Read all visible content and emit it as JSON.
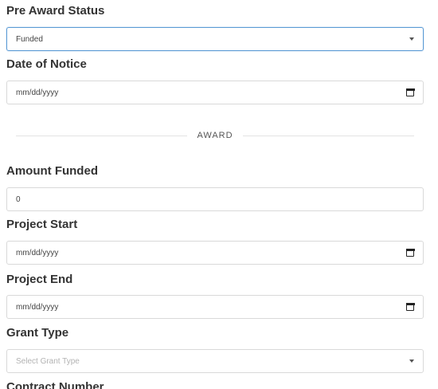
{
  "pre_award_status": {
    "label": "Pre Award Status",
    "value": "Funded"
  },
  "date_of_notice": {
    "label": "Date of Notice",
    "value": "mm/dd/yyyy"
  },
  "section": {
    "title": "AWARD"
  },
  "amount_funded": {
    "label": "Amount Funded",
    "value": "0"
  },
  "project_start": {
    "label": "Project Start",
    "value": "mm/dd/yyyy"
  },
  "project_end": {
    "label": "Project End",
    "value": "mm/dd/yyyy"
  },
  "grant_type": {
    "label": "Grant Type",
    "placeholder": "Select Grant Type"
  },
  "contract_number": {
    "label": "Contract Number"
  },
  "icons": {
    "select_caret": "chevron-down-icon",
    "date_picker": "calendar-icon"
  },
  "colors": {
    "focus_border": "#5b9bd5",
    "field_border": "#d9d9d9",
    "label_text": "#333333"
  }
}
